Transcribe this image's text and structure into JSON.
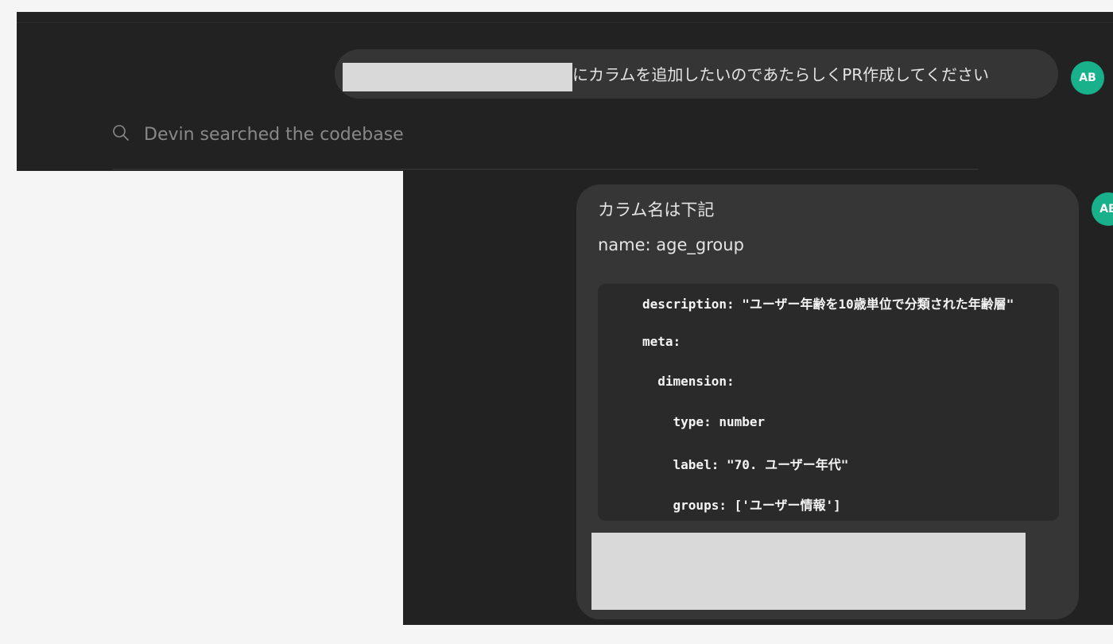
{
  "top_panel": {
    "user_message": {
      "text": "にカラムを追加したいのであたらしくPR作成してください",
      "redacted": true
    },
    "avatar": {
      "initials": "AB",
      "color": "#19b08c"
    },
    "activity": {
      "icon": "search-icon",
      "text": "Devin searched the codebase"
    }
  },
  "bottom_panel": {
    "user_message": {
      "line1": "カラム名は下記",
      "line2": "name: age_group",
      "code_lines": [
        "description: \"ユーザー年齢を10歳単位で分類された年齢層\"",
        "meta:",
        "  dimension:",
        "    type: number",
        "    label: \"70. ユーザー年代\"",
        "    groups: ['ユーザー情報']"
      ],
      "redacted_attachment": true
    },
    "avatar": {
      "initials": "AB",
      "color": "#19b08c"
    }
  }
}
